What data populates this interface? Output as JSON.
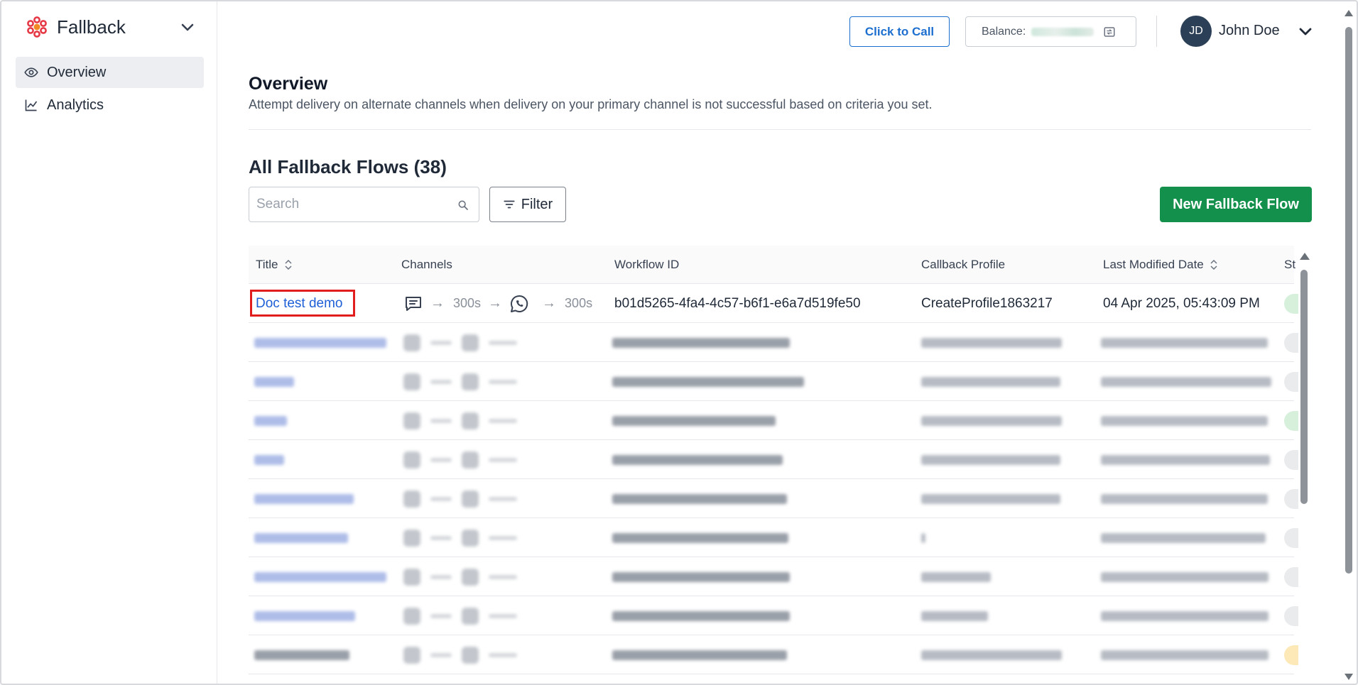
{
  "app": {
    "name": "Fallback",
    "accent_color": "#e63946"
  },
  "sidebar": {
    "items": [
      {
        "label": "Overview",
        "icon": "eye-icon",
        "active": true
      },
      {
        "label": "Analytics",
        "icon": "chart-line-icon",
        "active": false
      }
    ]
  },
  "topbar": {
    "click_to_call_label": "Click to Call",
    "balance_label": "Balance:",
    "user": {
      "initials": "JD",
      "name": "John Doe"
    }
  },
  "page": {
    "title": "Overview",
    "description": "Attempt delivery on alternate channels when delivery on your primary channel is not successful based on criteria you set.",
    "section_title": "All Fallback Flows (38)",
    "search_placeholder": "Search",
    "filter_label": "Filter",
    "new_flow_label": "New Fallback Flow"
  },
  "table": {
    "columns": [
      "Title",
      "Channels",
      "Workflow ID",
      "Callback Profile",
      "Last Modified Date",
      "St"
    ],
    "first_row": {
      "title": "Doc test demo",
      "channel_1_duration": "300s",
      "channel_2_duration": "300s",
      "arrow": "→",
      "workflow_id": "b01d5265-4fa4-4c57-b6f1-e6a7d519fe50",
      "callback_profile": "CreateProfile1863217",
      "last_modified": "04 Apr 2025, 05:43:09 PM",
      "status_color": "#d6f0dc"
    },
    "blurred_rows": [
      {
        "status_color": "#eaebed",
        "title_type": "link"
      },
      {
        "status_color": "#eaebed",
        "title_type": "link"
      },
      {
        "status_color": "#d6f0dc",
        "title_type": "link"
      },
      {
        "status_color": "#eaebed",
        "title_type": "link"
      },
      {
        "status_color": "#eaebed",
        "title_type": "link"
      },
      {
        "status_color": "#eaebed",
        "title_type": "link"
      },
      {
        "status_color": "#eaebed",
        "title_type": "link"
      },
      {
        "status_color": "#eaebed",
        "title_type": "link"
      },
      {
        "status_color": "#fde9b8",
        "title_type": "dark"
      }
    ]
  }
}
